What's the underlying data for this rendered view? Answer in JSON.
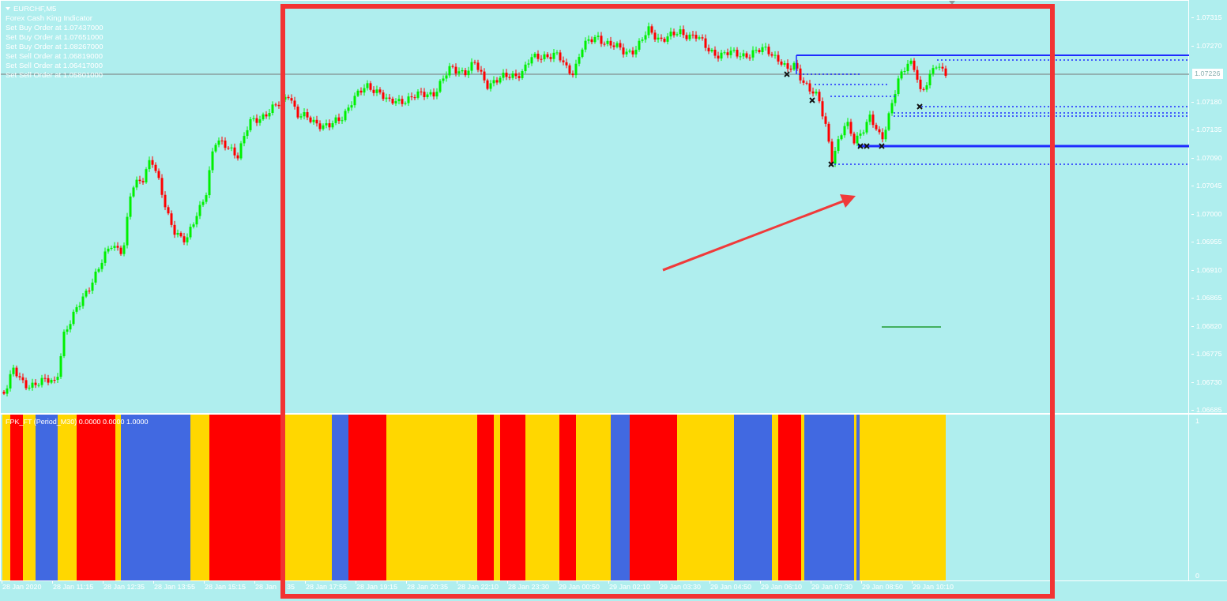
{
  "chart": {
    "symbol": "EURCHF,M5",
    "indicator": "Forex Cash King Indicator",
    "orders": [
      "Set Buy Order at 1.07437000",
      "Set Buy Order at 1.07651000",
      "Set Buy Order at 1.08267000",
      "Set Sell Order at 1.06819000",
      "Set Sell Order at 1.06417000",
      "Set Sell Order at 1.05801000"
    ],
    "price_axis": [
      {
        "text": "1.07315",
        "kind": "tick"
      },
      {
        "text": "1.07270",
        "kind": "tick"
      },
      {
        "text": "1.07226",
        "kind": "current"
      },
      {
        "text": "1.07180",
        "kind": "tick"
      },
      {
        "text": "1.07135",
        "kind": "tick"
      },
      {
        "text": "1.07090",
        "kind": "tick"
      },
      {
        "text": "1.07045",
        "kind": "tick"
      },
      {
        "text": "1.07000",
        "kind": "tick"
      },
      {
        "text": "1.06955",
        "kind": "tick"
      },
      {
        "text": "1.06910",
        "kind": "tick"
      },
      {
        "text": "1.06865",
        "kind": "tick"
      },
      {
        "text": "1.06820",
        "kind": "tick"
      },
      {
        "text": "1.06775",
        "kind": "tick"
      },
      {
        "text": "1.06730",
        "kind": "tick"
      },
      {
        "text": "1.06685",
        "kind": "tick"
      }
    ]
  },
  "subwindow": {
    "label": "FPK_FT (Period_M30) 0.0000 0.0000 1.0000",
    "axis": [
      "1",
      "0"
    ],
    "bands": [
      {
        "color": "#ffd700"
      },
      {
        "color": "#ff0000"
      },
      {
        "color": "#ffd700"
      },
      {
        "color": "#4169e1"
      },
      {
        "color": "#ffd700"
      },
      {
        "color": "#ff0000"
      },
      {
        "color": "#ffd700"
      },
      {
        "color": "#4169e1"
      },
      {
        "color": "#ffd700"
      },
      {
        "color": "#ff0000"
      },
      {
        "color": "#ffd700"
      },
      {
        "color": "#4169e1"
      },
      {
        "color": "#ff0000"
      },
      {
        "color": "#ffd700"
      },
      {
        "color": "#ff0000"
      },
      {
        "color": "#ffd700"
      },
      {
        "color": "#ff0000"
      },
      {
        "color": "#ffd700"
      },
      {
        "color": "#ff0000"
      },
      {
        "color": "#ffd700"
      },
      {
        "color": "#4169e1"
      },
      {
        "color": "#ff0000"
      },
      {
        "color": "#ffd700"
      },
      {
        "color": "#4169e1"
      },
      {
        "color": "#ffd700"
      },
      {
        "color": "#ff0000"
      },
      {
        "color": "#ffd700"
      },
      {
        "color": "#4169e1"
      },
      {
        "color": "#ffd700"
      },
      {
        "color": "#4169e1"
      },
      {
        "color": "#ffd700"
      }
    ]
  },
  "time_axis": [
    {
      "text": "28 Jan 2020",
      "kind": "tick"
    },
    {
      "text": "28 Jan 11:15",
      "kind": "tick"
    },
    {
      "text": "28 Jan 12:35",
      "kind": "tick"
    },
    {
      "text": "28 Jan 13:55",
      "kind": "tick"
    },
    {
      "text": "28 Jan 15:15",
      "kind": "tick"
    },
    {
      "text": "28 Jan",
      "kind": "cut"
    },
    {
      "text": "35",
      "kind": "tail"
    },
    {
      "text": "28 Jan 17:55",
      "kind": "tick"
    },
    {
      "text": "28 Jan 19:15",
      "kind": "tick"
    },
    {
      "text": "28 Jan 20:35",
      "kind": "tick"
    },
    {
      "text": "28 Jan 22:10",
      "kind": "tick"
    },
    {
      "text": "28 Jan 23:30",
      "kind": "tick"
    },
    {
      "text": "29 Jan 00:50",
      "kind": "tick"
    },
    {
      "text": "29 Jan 02:10",
      "kind": "tick"
    },
    {
      "text": "29 Jan 03:30",
      "kind": "tick"
    },
    {
      "text": "29 Jan 04:50",
      "kind": "tick"
    },
    {
      "text": "29 Jan 06:10",
      "kind": "tick"
    },
    {
      "text": "29 Jan 07:30",
      "kind": "tick"
    },
    {
      "text": "29 Jan 08:50",
      "kind": "tick"
    },
    {
      "text": "29 Jan 10:10",
      "kind": "tick"
    }
  ]
}
